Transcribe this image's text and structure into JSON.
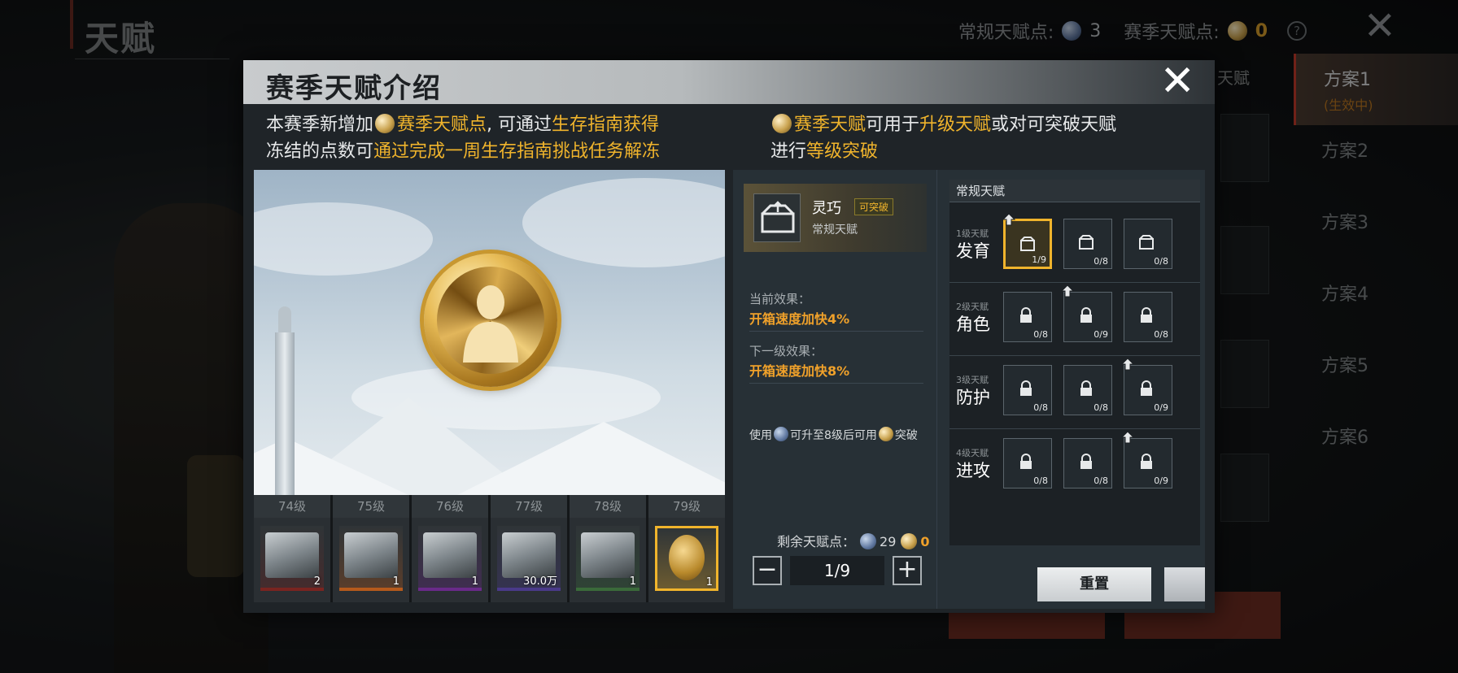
{
  "background": {
    "title": "天赋",
    "points": {
      "normal_label": "常规天赋点:",
      "normal_value": "3",
      "season_label": "赛季天赋点:",
      "season_value": "0",
      "help": "?"
    },
    "close": "✕",
    "talent_tag": "天赋",
    "schemes": [
      {
        "label": "方案1",
        "sub": "(生效中)"
      },
      {
        "label": "方案2"
      },
      {
        "label": "方案3"
      },
      {
        "label": "方案4"
      },
      {
        "label": "方案5"
      },
      {
        "label": "方案6"
      }
    ]
  },
  "modal": {
    "title": "赛季天赋介绍",
    "close": "✕",
    "desc_left": {
      "l1_a": "本赛季新增加",
      "l1_b": "赛季天赋点",
      "l1_c": ", 可通过",
      "l1_d": "生存指南获得",
      "l2_a": "冻结的点数可",
      "l2_b": "通过完成一周生存指南挑战任务解冻"
    },
    "desc_right": {
      "l1_a": "赛季天赋",
      "l1_b": "可用于",
      "l1_c": "升级天赋",
      "l1_d": "或对可突破天赋",
      "l2_a": "进行",
      "l2_b": "等级突破"
    },
    "levels": [
      {
        "label": "74级",
        "count": "2",
        "color": "#7a2420"
      },
      {
        "label": "75级",
        "count": "1",
        "color": "#b65a1c"
      },
      {
        "label": "76级",
        "count": "1",
        "color": "#6a2a8a"
      },
      {
        "label": "77级",
        "count": "30.0万",
        "color": "#4a3a8a"
      },
      {
        "label": "78级",
        "count": "1",
        "color": "#3a6a3a"
      },
      {
        "label": "79级",
        "count": "1",
        "color": "#f0b42c",
        "selected": true
      }
    ],
    "talent": {
      "name": "灵巧",
      "tag": "可突破",
      "type": "常规天赋",
      "current_label": "当前效果：",
      "current_value": "开箱速度加快4%",
      "next_label": "下一级效果：",
      "next_value": "开箱速度加快8%",
      "hint_a": "使用",
      "hint_b": "可升至8级后可用",
      "hint_c": "突破",
      "remain_label": "剩余天赋点：",
      "remain_normal": "29",
      "remain_season": "0",
      "stepper_value": "1/9",
      "minus": "−",
      "plus": "+"
    },
    "tree": {
      "header": "常规天赋",
      "tiers": [
        {
          "level": "1级天赋",
          "name": "发育",
          "nodes": [
            "1/9",
            "0/8",
            "0/8"
          ]
        },
        {
          "level": "2级天赋",
          "name": "角色",
          "nodes": [
            "0/8",
            "0/9",
            "0/8"
          ]
        },
        {
          "level": "3级天赋",
          "name": "防护",
          "nodes": [
            "0/8",
            "0/8",
            "0/9"
          ]
        },
        {
          "level": "4级天赋",
          "name": "进攻",
          "nodes": [
            "0/8",
            "0/8",
            "0/9"
          ]
        }
      ]
    },
    "reset_label": "重置"
  },
  "colors": {
    "accent": "#f0b42c",
    "effect": "#f0a12a",
    "header_light": "#c8cbcd",
    "panel": "#1f2428"
  }
}
